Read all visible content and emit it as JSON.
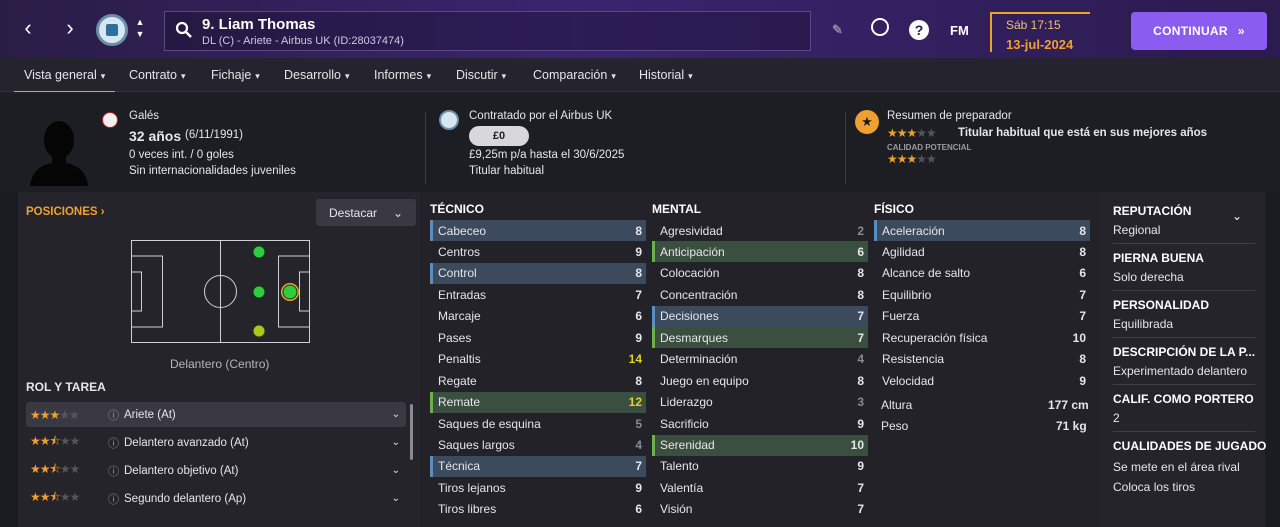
{
  "header": {
    "player_name": "9. Liam Thomas",
    "player_sub": "DL (C) - Ariete - Airbus UK (ID:28037474)",
    "fm_label": "FM",
    "help_label": "?",
    "date_day": "Sáb 17:15",
    "date_full": "13-jul-2024",
    "continue_label": "CONTINUAR"
  },
  "tabs": [
    {
      "label": "Vista general"
    },
    {
      "label": "Contrato"
    },
    {
      "label": "Fichaje"
    },
    {
      "label": "Desarrollo"
    },
    {
      "label": "Informes"
    },
    {
      "label": "Discutir"
    },
    {
      "label": "Comparación"
    },
    {
      "label": "Historial"
    }
  ],
  "info": {
    "nationality": "Galés",
    "age": "32 años",
    "birth": "(6/11/1991)",
    "caps": "0 veces int. / 0 goles",
    "youth": "Sin internacionalidades juveniles",
    "contracted_by": "Contratado por el Airbus UK",
    "value": "£0",
    "wage": "£9,25m p/a hasta el 30/6/2025",
    "status": "Titular habitual",
    "coach_title": "Resumen de preparador",
    "coach_text": "Titular habitual que está en sus mejores años",
    "potential_label": "CALIDAD POTENCIAL",
    "current_stars": 3,
    "potential_stars": 3
  },
  "positions": {
    "title": "POSICIONES",
    "highlight_label": "Destacar",
    "position_label": "Delantero (Centro)"
  },
  "roles": {
    "title": "ROL Y TAREA",
    "items": [
      {
        "stars": "3",
        "label": "Ariete (At)"
      },
      {
        "stars": "2.5",
        "label": "Delantero avanzado (At)"
      },
      {
        "stars": "2.5",
        "label": "Delantero objetivo (At)"
      },
      {
        "stars": "2.5",
        "label": "Segundo delantero (Ap)"
      }
    ]
  },
  "attributes": {
    "technical_title": "TÉCNICO",
    "mental_title": "MENTAL",
    "physical_title": "FÍSICO",
    "technical": [
      {
        "name": "Cabeceo",
        "value": "8"
      },
      {
        "name": "Centros",
        "value": "9"
      },
      {
        "name": "Control",
        "value": "8"
      },
      {
        "name": "Entradas",
        "value": "7"
      },
      {
        "name": "Marcaje",
        "value": "6"
      },
      {
        "name": "Pases",
        "value": "9"
      },
      {
        "name": "Penaltis",
        "value": "14"
      },
      {
        "name": "Regate",
        "value": "8"
      },
      {
        "name": "Remate",
        "value": "12"
      },
      {
        "name": "Saques de esquina",
        "value": "5"
      },
      {
        "name": "Saques largos",
        "value": "4"
      },
      {
        "name": "Técnica",
        "value": "7"
      },
      {
        "name": "Tiros lejanos",
        "value": "9"
      },
      {
        "name": "Tiros libres",
        "value": "6"
      }
    ],
    "mental": [
      {
        "name": "Agresividad",
        "value": "2"
      },
      {
        "name": "Anticipación",
        "value": "6"
      },
      {
        "name": "Colocación",
        "value": "8"
      },
      {
        "name": "Concentración",
        "value": "8"
      },
      {
        "name": "Decisiones",
        "value": "7"
      },
      {
        "name": "Desmarques",
        "value": "7"
      },
      {
        "name": "Determinación",
        "value": "4"
      },
      {
        "name": "Juego en equipo",
        "value": "8"
      },
      {
        "name": "Liderazgo",
        "value": "3"
      },
      {
        "name": "Sacrificio",
        "value": "9"
      },
      {
        "name": "Serenidad",
        "value": "10"
      },
      {
        "name": "Talento",
        "value": "9"
      },
      {
        "name": "Valentía",
        "value": "7"
      },
      {
        "name": "Visión",
        "value": "7"
      }
    ],
    "physical": [
      {
        "name": "Aceleración",
        "value": "8"
      },
      {
        "name": "Agilidad",
        "value": "8"
      },
      {
        "name": "Alcance de salto",
        "value": "6"
      },
      {
        "name": "Equilibrio",
        "value": "7"
      },
      {
        "name": "Fuerza",
        "value": "7"
      },
      {
        "name": "Recuperación física",
        "value": "10"
      },
      {
        "name": "Resistencia",
        "value": "8"
      },
      {
        "name": "Velocidad",
        "value": "9"
      }
    ],
    "height_label": "Altura",
    "height": "177 cm",
    "weight_label": "Peso",
    "weight": "71 kg"
  },
  "side": {
    "reputation_title": "REPUTACIÓN",
    "reputation": "Regional",
    "foot_title": "PIERNA BUENA",
    "foot": "Solo derecha",
    "personality_title": "PERSONALIDAD",
    "personality": "Equilibrada",
    "desc_title": "DESCRIPCIÓN DE LA P...",
    "desc": "Experimentado delantero",
    "gk_title": "CALIF. COMO PORTERO",
    "gk": "2",
    "qualities_title": "CUALIDADES DE JUGADO",
    "qualities": [
      "Se mete en el área rival",
      "Coloca los tiros"
    ]
  },
  "colors": {
    "accent": "#f0a030",
    "continue_button": "#8a5cf0",
    "highlight_blue": "#3b4a5c",
    "highlight_green": "#3a4f3f",
    "dot_green": "#2ecc40",
    "dot_yellowgreen": "#a8c81e"
  }
}
